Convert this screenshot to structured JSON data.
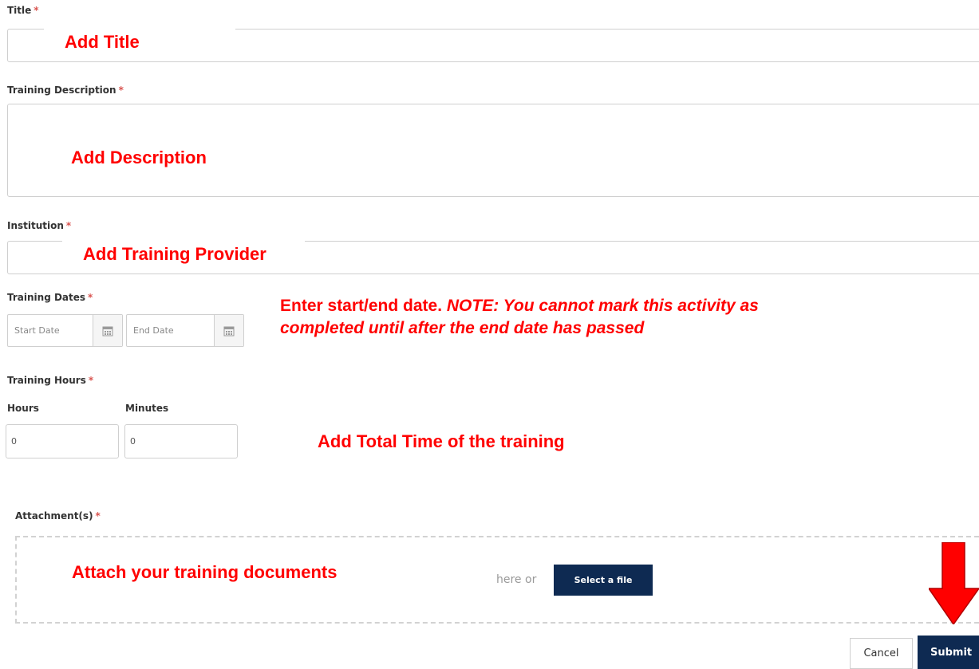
{
  "form": {
    "title_label": "Title",
    "description_label": "Training Description",
    "institution_label": "Institution",
    "dates_label": "Training Dates",
    "hours_section_label": "Training Hours",
    "hours_label": "Hours",
    "minutes_label": "Minutes",
    "attachments_label": "Attachment(s)",
    "required_marker": "*",
    "start_date_placeholder": "Start Date",
    "end_date_placeholder": "End Date",
    "hours_value": "0",
    "minutes_value": "0",
    "dropzone_text": "here or",
    "select_file_label": "Select a file",
    "cancel_label": "Cancel",
    "submit_label": "Submit"
  },
  "annotations": {
    "title": "Add Title",
    "description": "Add Description",
    "institution": "Add Training Provider",
    "dates_line1_a": "Enter start/end date. ",
    "dates_line1_b": "NOTE: You cannot mark this activity as",
    "dates_line2": "completed until after the end date has passed",
    "hours": "Add Total Time of the training",
    "attachments": "Attach your training documents"
  },
  "icons": {
    "calendar": "calendar-icon",
    "arrow": "red-down-arrow"
  },
  "colors": {
    "annotation": "#ff0000",
    "required": "#d9534f",
    "primary_button": "#0e2a52"
  }
}
